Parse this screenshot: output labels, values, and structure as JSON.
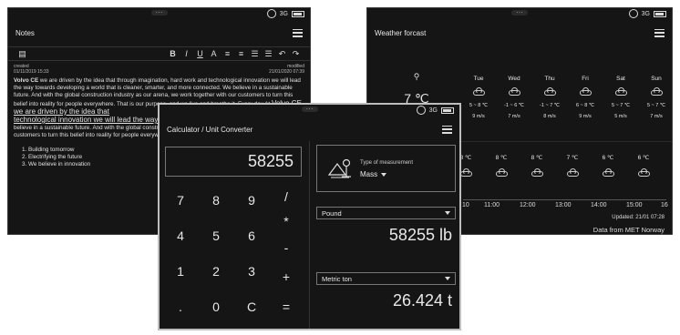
{
  "status": {
    "network": "3G"
  },
  "notes": {
    "title": "Notes",
    "toolbar": {
      "bold": "B",
      "italic": "I",
      "underline": "U",
      "text_size": "A",
      "undo": "↶",
      "redo": "↷"
    },
    "created_label": "created",
    "created_date": "01/11/2019 15:33",
    "modified_label": "modified",
    "modified_date": "21/01/2020 07:39",
    "body_p1_bold": "Volvo CE",
    "body_p1": " we are driven by the idea that through imagination, hard work and technological innovation we will lead the way towards developing a world that is cleaner, smarter, and more connected. We believe in a sustainable future. And with the global construction industry as our arena, we work together with our customers to turn this belief into reality for people everywhere. That is our purpose, and we live and breathe it. Every day.At ",
    "body_p1_link": "Volvo CE we are driven by the idea that",
    "body_underline": "technological innovation we will lead the way towards smarter, and more connected.",
    "body_p2": " We believe in a sustainable future. And with the global construction industry as our arena, we work together with our customers to turn this belief into reality for people everywhere. That is our purpose, and we live and breathe it.",
    "list": [
      "Building tomorrow",
      "Electrifying the future",
      "We believe in innovation"
    ]
  },
  "weather": {
    "title": "Weather forcast",
    "current_temp": "7 ℃",
    "days": [
      {
        "name": "Tue",
        "range": "5 ~ 8 ℃",
        "wind": "9 m/s",
        "icon": "cloud-icon"
      },
      {
        "name": "Wed",
        "range": "-1 ~ 6 ℃",
        "wind": "7 m/s",
        "icon": "cloud-icon"
      },
      {
        "name": "Thu",
        "range": "-1 ~ 7 ℃",
        "wind": "8 m/s",
        "icon": "cloud-icon"
      },
      {
        "name": "Fri",
        "range": "6 ~ 8 ℃",
        "wind": "9 m/s",
        "icon": "cloud-icon"
      },
      {
        "name": "Sat",
        "range": "5 ~ 7 ℃",
        "wind": "5 m/s",
        "icon": "cloud-icon"
      },
      {
        "name": "Sun",
        "range": "5 ~ 7 ℃",
        "wind": "7 m/s",
        "icon": "rain-cloud-icon"
      }
    ],
    "hourly": [
      {
        "temp": "8 ℃"
      },
      {
        "temp": "8 ℃"
      },
      {
        "temp": "8 ℃"
      },
      {
        "temp": "7 ℃"
      },
      {
        "temp": "6 ℃"
      },
      {
        "temp": "6 ℃"
      }
    ],
    "times": [
      "10",
      "11:00",
      "12:00",
      "13:00",
      "14:00",
      "15:00",
      "16"
    ],
    "updated": "Updated: 21/01 07:28",
    "source": "Data from MET Norway"
  },
  "calculator": {
    "title": "Calculator / Unit Converter",
    "display": "58255",
    "keys": [
      "7",
      "8",
      "9",
      "/",
      "4",
      "5",
      "6",
      "*",
      "1",
      "2",
      "3",
      "-",
      ".",
      "0",
      "C",
      "+",
      "="
    ],
    "measurement_label": "Type of measurement",
    "measurement_value": "Mass",
    "from_unit": "Pound",
    "from_value": "58255 lb",
    "to_unit": "Metric ton",
    "to_value": "26.424 t"
  }
}
